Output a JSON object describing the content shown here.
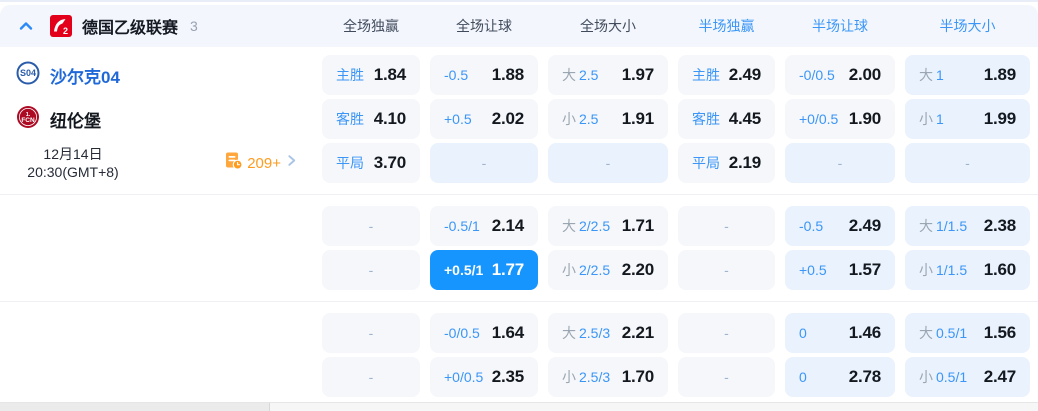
{
  "colors": {
    "accent_blue": "#3b96f7",
    "selected_cell_bg": "#1795ff",
    "team_name_blue": "#1f68d8",
    "more_markets_orange": "#ff9b1f",
    "cell_gray_bg": "#f5f7fa",
    "cell_blue_bg": "#e9f2fd",
    "header_bg": "#f3f7fd"
  },
  "header": {
    "collapse_icon": "chevron-up",
    "league_logo": "bundesliga-2-badge",
    "league": "德国乙级联赛",
    "count": "3",
    "columns": [
      {
        "label": "全场独赢",
        "group": "ft"
      },
      {
        "label": "全场让球",
        "group": "ft"
      },
      {
        "label": "全场大小",
        "group": "ft"
      },
      {
        "label": "半场独赢",
        "group": "ht"
      },
      {
        "label": "半场让球",
        "group": "ht"
      },
      {
        "label": "半场大小",
        "group": "ht"
      }
    ]
  },
  "match": {
    "home": "沙尔克04",
    "away": "纽伦堡",
    "date": "12月14日",
    "time": "20:30(GMT+8)",
    "more": "209+"
  },
  "misc": {
    "dash": "-"
  },
  "blocks": [
    [
      {
        "cells": [
          {
            "l2": "主胜",
            "value": "1.84",
            "variant": "gray"
          },
          {
            "l2": "-0.5",
            "value": "1.88",
            "variant": "gray"
          },
          {
            "l1": "大",
            "l2": "2.5",
            "value": "1.97",
            "variant": "gray"
          },
          {
            "l2": "主胜",
            "value": "2.49",
            "variant": "gray"
          },
          {
            "l2": "-0/0.5",
            "value": "2.00",
            "variant": "gray"
          },
          {
            "l1": "大",
            "l2": "1",
            "value": "1.89",
            "variant": "blue"
          }
        ]
      },
      {
        "cells": [
          {
            "l2": "客胜",
            "value": "4.10",
            "variant": "gray"
          },
          {
            "l2": "+0.5",
            "value": "2.02",
            "variant": "gray"
          },
          {
            "l1": "小",
            "l2": "2.5",
            "value": "1.91",
            "variant": "gray"
          },
          {
            "l2": "客胜",
            "value": "4.45",
            "variant": "gray"
          },
          {
            "l2": "+0/0.5",
            "value": "1.90",
            "variant": "gray"
          },
          {
            "l1": "小",
            "l2": "1",
            "value": "1.99",
            "variant": "blue"
          }
        ]
      },
      {
        "cells": [
          {
            "l2": "平局",
            "value": "3.70",
            "variant": "gray"
          },
          {
            "dash": true,
            "variant": "blue"
          },
          {
            "dash": true,
            "variant": "blue"
          },
          {
            "l2": "平局",
            "value": "2.19",
            "variant": "gray"
          },
          {
            "dash": true,
            "variant": "blue"
          },
          {
            "dash": true,
            "variant": "blue"
          }
        ]
      }
    ],
    [
      {
        "cells": [
          {
            "dash": true,
            "variant": "gray"
          },
          {
            "l2": "-0.5/1",
            "value": "2.14",
            "variant": "gray"
          },
          {
            "l1": "大",
            "l2": "2/2.5",
            "value": "1.71",
            "variant": "gray"
          },
          {
            "dash": true,
            "variant": "gray"
          },
          {
            "l2": "-0.5",
            "value": "2.49",
            "variant": "blue"
          },
          {
            "l1": "大",
            "l2": "1/1.5",
            "value": "2.38",
            "variant": "blue"
          }
        ]
      },
      {
        "cells": [
          {
            "dash": true,
            "variant": "gray"
          },
          {
            "l2": "+0.5/1",
            "value": "1.77",
            "variant": "selected"
          },
          {
            "l1": "小",
            "l2": "2/2.5",
            "value": "2.20",
            "variant": "gray"
          },
          {
            "dash": true,
            "variant": "gray"
          },
          {
            "l2": "+0.5",
            "value": "1.57",
            "variant": "blue"
          },
          {
            "l1": "小",
            "l2": "1/1.5",
            "value": "1.60",
            "variant": "blue"
          }
        ]
      }
    ],
    [
      {
        "cells": [
          {
            "dash": true,
            "variant": "gray"
          },
          {
            "l2": "-0/0.5",
            "value": "1.64",
            "variant": "gray"
          },
          {
            "l1": "大",
            "l2": "2.5/3",
            "value": "2.21",
            "variant": "gray"
          },
          {
            "dash": true,
            "variant": "gray"
          },
          {
            "l2": "0",
            "value": "1.46",
            "variant": "blue"
          },
          {
            "l1": "大",
            "l2": "0.5/1",
            "value": "1.56",
            "variant": "blue"
          }
        ]
      },
      {
        "cells": [
          {
            "dash": true,
            "variant": "gray"
          },
          {
            "l2": "+0/0.5",
            "value": "2.35",
            "variant": "gray"
          },
          {
            "l1": "小",
            "l2": "2.5/3",
            "value": "1.70",
            "variant": "gray"
          },
          {
            "dash": true,
            "variant": "gray"
          },
          {
            "l2": "0",
            "value": "2.78",
            "variant": "blue"
          },
          {
            "l1": "小",
            "l2": "0.5/1",
            "value": "2.47",
            "variant": "blue"
          }
        ]
      }
    ]
  ]
}
